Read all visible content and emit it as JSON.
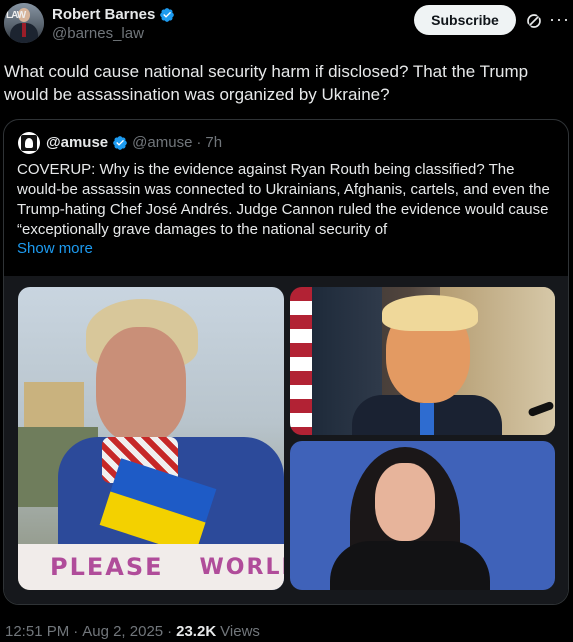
{
  "author": {
    "name": "Robert Barnes",
    "handle": "@barnes_law",
    "avatar_label": "LAW"
  },
  "actions": {
    "subscribe_label": "Subscribe",
    "more_label": "···"
  },
  "tweet": {
    "text": "What could cause national security harm if disclosed? That the Trump would be assassination was organized by Ukraine?"
  },
  "quote": {
    "name": "@amuse",
    "handle": "@amuse",
    "separator": "·",
    "time": "7h",
    "text": "COVERUP: Why is the evidence against Ryan Routh being classified? The would-be assassin was connected to Ukrainians, Afghanis, cartels, and even the Trump-hating Chef José Andrés. Judge Cannon ruled the evidence would cause “exceptionally grave damages to the national security of",
    "show_more": "Show more",
    "media": {
      "sign_words": [
        "PLEASE",
        "WORLD"
      ]
    }
  },
  "footer": {
    "time": "12:51 PM",
    "sep1": "·",
    "date": "Aug 2, 2025",
    "sep2": "·",
    "views_count": "23.2K",
    "views_label": "Views"
  },
  "colors": {
    "background": "#000000",
    "text": "#e7e9ea",
    "muted": "#71767b",
    "link": "#1d9bf0",
    "verified": "#1d9bf0",
    "border": "#2f3336"
  },
  "icons": [
    "verified-badge-icon",
    "grok-icon",
    "more-icon"
  ]
}
